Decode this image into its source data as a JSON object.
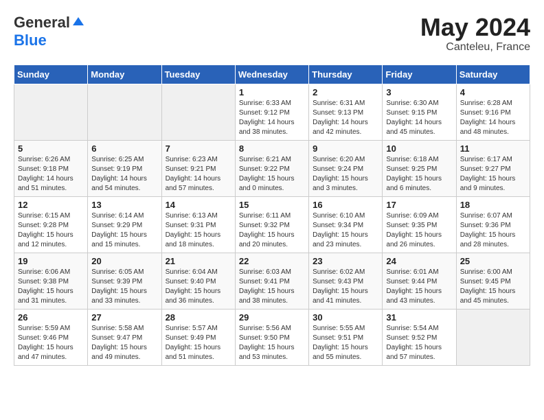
{
  "header": {
    "logo_general": "General",
    "logo_blue": "Blue",
    "month_year": "May 2024",
    "location": "Canteleu, France"
  },
  "weekdays": [
    "Sunday",
    "Monday",
    "Tuesday",
    "Wednesday",
    "Thursday",
    "Friday",
    "Saturday"
  ],
  "weeks": [
    [
      {
        "day": "",
        "empty": true
      },
      {
        "day": "",
        "empty": true
      },
      {
        "day": "",
        "empty": true
      },
      {
        "day": "1",
        "sunrise": "6:33 AM",
        "sunset": "9:12 PM",
        "daylight": "14 hours and 38 minutes."
      },
      {
        "day": "2",
        "sunrise": "6:31 AM",
        "sunset": "9:13 PM",
        "daylight": "14 hours and 42 minutes."
      },
      {
        "day": "3",
        "sunrise": "6:30 AM",
        "sunset": "9:15 PM",
        "daylight": "14 hours and 45 minutes."
      },
      {
        "day": "4",
        "sunrise": "6:28 AM",
        "sunset": "9:16 PM",
        "daylight": "14 hours and 48 minutes."
      }
    ],
    [
      {
        "day": "5",
        "sunrise": "6:26 AM",
        "sunset": "9:18 PM",
        "daylight": "14 hours and 51 minutes."
      },
      {
        "day": "6",
        "sunrise": "6:25 AM",
        "sunset": "9:19 PM",
        "daylight": "14 hours and 54 minutes."
      },
      {
        "day": "7",
        "sunrise": "6:23 AM",
        "sunset": "9:21 PM",
        "daylight": "14 hours and 57 minutes."
      },
      {
        "day": "8",
        "sunrise": "6:21 AM",
        "sunset": "9:22 PM",
        "daylight": "15 hours and 0 minutes."
      },
      {
        "day": "9",
        "sunrise": "6:20 AM",
        "sunset": "9:24 PM",
        "daylight": "15 hours and 3 minutes."
      },
      {
        "day": "10",
        "sunrise": "6:18 AM",
        "sunset": "9:25 PM",
        "daylight": "15 hours and 6 minutes."
      },
      {
        "day": "11",
        "sunrise": "6:17 AM",
        "sunset": "9:27 PM",
        "daylight": "15 hours and 9 minutes."
      }
    ],
    [
      {
        "day": "12",
        "sunrise": "6:15 AM",
        "sunset": "9:28 PM",
        "daylight": "15 hours and 12 minutes."
      },
      {
        "day": "13",
        "sunrise": "6:14 AM",
        "sunset": "9:29 PM",
        "daylight": "15 hours and 15 minutes."
      },
      {
        "day": "14",
        "sunrise": "6:13 AM",
        "sunset": "9:31 PM",
        "daylight": "15 hours and 18 minutes."
      },
      {
        "day": "15",
        "sunrise": "6:11 AM",
        "sunset": "9:32 PM",
        "daylight": "15 hours and 20 minutes."
      },
      {
        "day": "16",
        "sunrise": "6:10 AM",
        "sunset": "9:34 PM",
        "daylight": "15 hours and 23 minutes."
      },
      {
        "day": "17",
        "sunrise": "6:09 AM",
        "sunset": "9:35 PM",
        "daylight": "15 hours and 26 minutes."
      },
      {
        "day": "18",
        "sunrise": "6:07 AM",
        "sunset": "9:36 PM",
        "daylight": "15 hours and 28 minutes."
      }
    ],
    [
      {
        "day": "19",
        "sunrise": "6:06 AM",
        "sunset": "9:38 PM",
        "daylight": "15 hours and 31 minutes."
      },
      {
        "day": "20",
        "sunrise": "6:05 AM",
        "sunset": "9:39 PM",
        "daylight": "15 hours and 33 minutes."
      },
      {
        "day": "21",
        "sunrise": "6:04 AM",
        "sunset": "9:40 PM",
        "daylight": "15 hours and 36 minutes."
      },
      {
        "day": "22",
        "sunrise": "6:03 AM",
        "sunset": "9:41 PM",
        "daylight": "15 hours and 38 minutes."
      },
      {
        "day": "23",
        "sunrise": "6:02 AM",
        "sunset": "9:43 PM",
        "daylight": "15 hours and 41 minutes."
      },
      {
        "day": "24",
        "sunrise": "6:01 AM",
        "sunset": "9:44 PM",
        "daylight": "15 hours and 43 minutes."
      },
      {
        "day": "25",
        "sunrise": "6:00 AM",
        "sunset": "9:45 PM",
        "daylight": "15 hours and 45 minutes."
      }
    ],
    [
      {
        "day": "26",
        "sunrise": "5:59 AM",
        "sunset": "9:46 PM",
        "daylight": "15 hours and 47 minutes."
      },
      {
        "day": "27",
        "sunrise": "5:58 AM",
        "sunset": "9:47 PM",
        "daylight": "15 hours and 49 minutes."
      },
      {
        "day": "28",
        "sunrise": "5:57 AM",
        "sunset": "9:49 PM",
        "daylight": "15 hours and 51 minutes."
      },
      {
        "day": "29",
        "sunrise": "5:56 AM",
        "sunset": "9:50 PM",
        "daylight": "15 hours and 53 minutes."
      },
      {
        "day": "30",
        "sunrise": "5:55 AM",
        "sunset": "9:51 PM",
        "daylight": "15 hours and 55 minutes."
      },
      {
        "day": "31",
        "sunrise": "5:54 AM",
        "sunset": "9:52 PM",
        "daylight": "15 hours and 57 minutes."
      },
      {
        "day": "",
        "empty": true
      }
    ]
  ]
}
